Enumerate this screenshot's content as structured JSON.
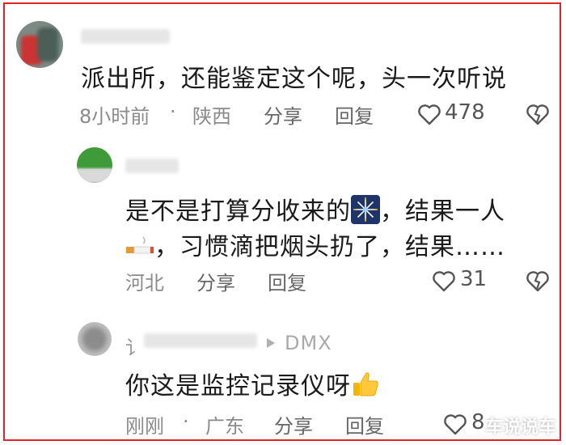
{
  "comments": [
    {
      "text": "派出所，还能鉴定这个呢，头一次听说",
      "time": "8小时前",
      "location": "陕西",
      "share_label": "分享",
      "reply_label": "回复",
      "likes": "478"
    },
    {
      "line1": "是不是打算分收来的",
      "line1_tail": "，结果一人",
      "line2": "，习惯滴把烟头扔了，结果……",
      "location": "河北",
      "share_label": "分享",
      "reply_label": "回复",
      "likes": "31"
    },
    {
      "username_visible": "讠",
      "device": "DMX",
      "text": "你这是监控记录仪呀",
      "time": "刚刚",
      "location": "广东",
      "share_label": "分享",
      "reply_label": "回复",
      "likes": "8"
    }
  ],
  "separator": "·",
  "watermark": "车说说车",
  "colors": {
    "border": "#e0242b",
    "text": "#1a1a1a",
    "meta": "#8a8a8a"
  },
  "icons": [
    "heart-icon",
    "dislike-heart-icon",
    "fireworks-emoji",
    "cigarette-emoji",
    "thumbs-up-emoji",
    "play-arrow-icon"
  ]
}
